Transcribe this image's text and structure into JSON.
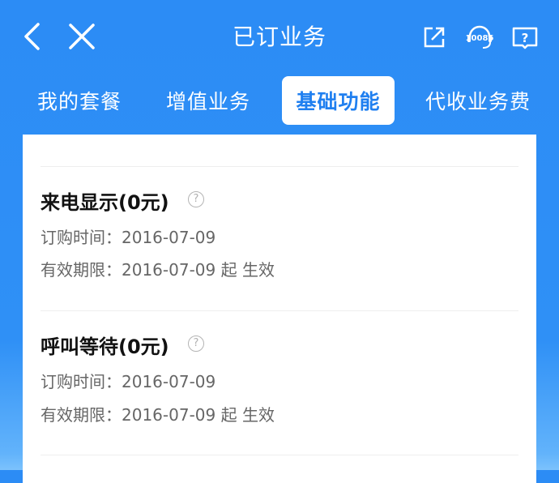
{
  "header": {
    "title": "已订业务",
    "icons": [
      "back-icon",
      "close-icon",
      "share-icon",
      "customer-service-icon",
      "help-book-icon"
    ],
    "service_badge": "10086"
  },
  "tabs": [
    {
      "label": "我的套餐",
      "active": false
    },
    {
      "label": "增值业务",
      "active": false
    },
    {
      "label": "基础功能",
      "active": true
    },
    {
      "label": "代收业务费",
      "active": false
    }
  ],
  "items": [
    {
      "title": "来电显示(0元)",
      "order_time": "订购时间：2016-07-09",
      "validity": "有效期限：2016-07-09 起 生效"
    },
    {
      "title": "呼叫等待(0元)",
      "order_time": "订购时间：2016-07-09",
      "validity": "有效期限：2016-07-09 起 生效"
    }
  ],
  "colors": {
    "primary": "#2c8cf5",
    "active_tab_text": "#1f7ff0",
    "card": "#ffffff"
  }
}
